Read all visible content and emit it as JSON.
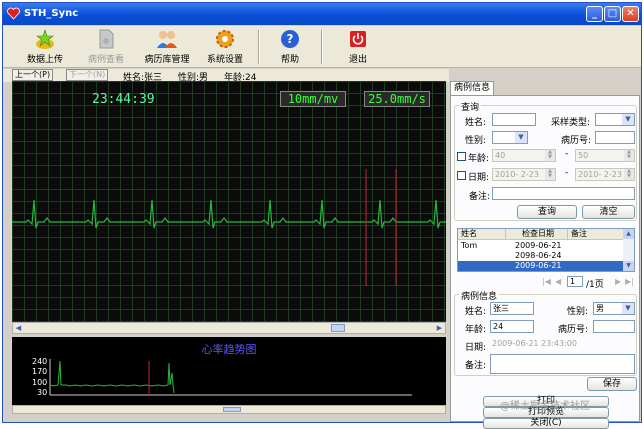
{
  "window": {
    "title": "STH_Sync"
  },
  "toolbar": {
    "upload": "数据上传",
    "view_case": "病例查看",
    "records_mgmt": "病历库管理",
    "settings": "系统设置",
    "help": "帮助",
    "exit": "退出"
  },
  "nav": {
    "prev": "上一个(P)",
    "next": "下一个(N)"
  },
  "patient_bar": {
    "name": "姓名:张三",
    "gender": "性别:男",
    "age": "年龄:24"
  },
  "ecg": {
    "time": "23:44:39",
    "gain": "10mm/mv",
    "speed": "25.0mm/s"
  },
  "trend": {
    "title": "心率趋势图",
    "y_ticks": [
      "240",
      "170",
      "100",
      "30"
    ]
  },
  "right_panel": {
    "tab": "病例信息",
    "query": {
      "title": "查询",
      "name_label": "姓名:",
      "name_value": "",
      "sample_type_label": "采样类型:",
      "sample_type_value": "",
      "gender_label": "性别:",
      "gender_value": "",
      "record_no_label": "病历号:",
      "record_no_value": "",
      "age_label": "年龄:",
      "age_from": "40",
      "age_to": "50",
      "dash": "-",
      "date_label": "日期:",
      "date_from": "2010- 2-23",
      "date_to": "2010- 2-23",
      "note_label": "备注:",
      "note_value": "",
      "query_button": "查询",
      "clear_button": "清空"
    },
    "list": {
      "headers": [
        "姓名",
        "检查日期",
        "备注"
      ],
      "rows": [
        {
          "name": "Tom",
          "date": "2009-06-21",
          "note": ""
        },
        {
          "name": "",
          "date": "2098-06-24",
          "note": ""
        },
        {
          "name": "",
          "date": "2009-06-21",
          "note": "",
          "selected": true
        }
      ],
      "page_value": "1",
      "page_total": "/1页"
    },
    "case": {
      "title": "病例信息",
      "name_label": "姓名:",
      "name_value": "张三",
      "gender_label": "性别:",
      "gender_value": "男",
      "age_label": "年龄:",
      "age_value": "24",
      "record_no_label": "病历号:",
      "record_no_value": "",
      "date_label": "日期:",
      "date_value": "2009-06-21 23:43:00",
      "note_label": "备注:",
      "note_value": "",
      "save_button": "保存"
    },
    "actions": {
      "print": "打印",
      "print_preview": "打印预览",
      "close": "关闭(C)"
    }
  },
  "watermark": "@稀土掘金技术社区",
  "colors": {
    "ecg_trace": "#27b83d",
    "marker": "#c8202a",
    "grid": "#1f3b1f",
    "title_bar": "#0a4fd8"
  }
}
